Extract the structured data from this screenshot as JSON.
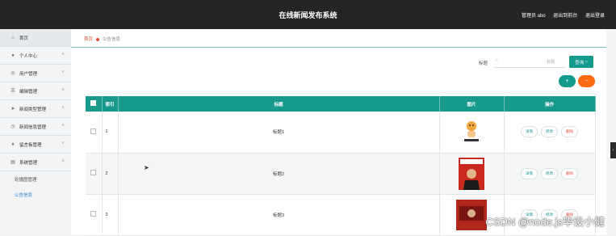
{
  "header": {
    "title": "在线新闻发布系统",
    "user": "管理员 abo",
    "links": [
      "退出到前台",
      "退出登录"
    ]
  },
  "sidebar": {
    "items": [
      {
        "label": "首页",
        "icon": "home-icon"
      },
      {
        "label": "个人中心",
        "icon": "user-icon"
      },
      {
        "label": "用户管理",
        "icon": "users-icon"
      },
      {
        "label": "编辑管理",
        "icon": "list-icon"
      },
      {
        "label": "新闻类型管理",
        "icon": "send-icon"
      },
      {
        "label": "新闻信息管理",
        "icon": "clock-icon"
      },
      {
        "label": "留言板管理",
        "icon": "mic-icon"
      },
      {
        "label": "系统管理",
        "icon": "database-icon"
      }
    ],
    "sub_items": [
      "轮播图管理",
      "公告信息"
    ]
  },
  "breadcrumb": {
    "home": "首页",
    "current": "公告信息"
  },
  "search": {
    "label": "标题",
    "placeholder": "标题",
    "button": "查询"
  },
  "toolbar": {
    "add": "+",
    "delete": "−"
  },
  "table": {
    "headers": [
      "索引",
      "标题",
      "图片",
      "操作"
    ],
    "rows": [
      {
        "index": "1",
        "title": "标题1"
      },
      {
        "index": "2",
        "title": "标题2"
      },
      {
        "index": "3",
        "title": "标题3"
      }
    ],
    "actions": [
      "详情",
      "修改",
      "删除"
    ]
  },
  "watermark": "CSDN @node.js毕设小健",
  "colors": {
    "accent": "#179a8b",
    "danger": "#ff6a10",
    "header": "#252525"
  }
}
